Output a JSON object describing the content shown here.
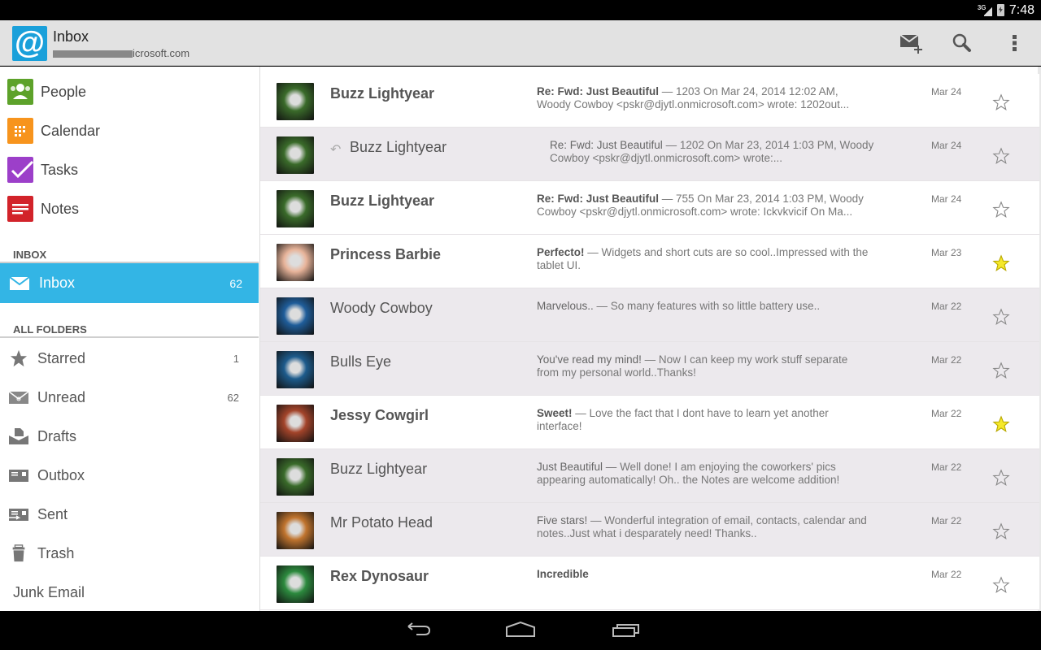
{
  "status_bar": {
    "network": "3G",
    "time": "7:48"
  },
  "action_bar": {
    "title": "Inbox",
    "account_visible_suffix": "icrosoft.com",
    "account_prefix_redacted": true,
    "actions": [
      {
        "name": "compose",
        "icon": "compose-mail-icon"
      },
      {
        "name": "search",
        "icon": "search-icon"
      },
      {
        "name": "overflow",
        "icon": "overflow-menu-icon"
      }
    ]
  },
  "sidebar": {
    "apps": [
      {
        "label": "People",
        "icon": "people-icon",
        "color": "#5da22a"
      },
      {
        "label": "Calendar",
        "icon": "calendar-icon",
        "color": "#f7941d"
      },
      {
        "label": "Tasks",
        "icon": "tasks-icon",
        "color": "#9c3fc9"
      },
      {
        "label": "Notes",
        "icon": "notes-icon",
        "color": "#d2232a"
      }
    ],
    "inbox_section": "INBOX",
    "selected": {
      "label": "Inbox",
      "count": "62",
      "icon": "mail-icon",
      "color": "#33b5e5"
    },
    "folders_section": "ALL FOLDERS",
    "folders": [
      {
        "label": "Starred",
        "count": "1",
        "icon": "star-icon"
      },
      {
        "label": "Unread",
        "count": "62",
        "icon": "unread-icon"
      },
      {
        "label": "Drafts",
        "count": "",
        "icon": "drafts-icon"
      },
      {
        "label": "Outbox",
        "count": "",
        "icon": "outbox-icon"
      },
      {
        "label": "Sent",
        "count": "",
        "icon": "sent-icon"
      },
      {
        "label": "Trash",
        "count": "",
        "icon": "trash-icon"
      },
      {
        "label": "Junk Email",
        "count": "",
        "icon": ""
      }
    ]
  },
  "messages": [
    {
      "sender": "Buzz Lightyear",
      "unread": true,
      "replied": false,
      "subject": "Re: Fwd: Just Beautiful",
      "preview": "1203 On Mar 24, 2014 12:02 AM, Woody Cowboy <pskr@djytl.onmicrosoft.com> wrote: 1202out...",
      "date": "Mar 24",
      "starred": false,
      "avatar_color": "#3a6b2a"
    },
    {
      "sender": "Buzz Lightyear",
      "unread": false,
      "replied": true,
      "subject": "Re: Fwd: Just Beautiful",
      "preview": "1202 On Mar 23, 2014 1:03 PM, Woody Cowboy <pskr@djytl.onmicrosoft.com> wrote:...",
      "date": "Mar 24",
      "starred": false,
      "avatar_color": "#3a6b2a"
    },
    {
      "sender": "Buzz Lightyear",
      "unread": true,
      "replied": false,
      "subject": "Re: Fwd: Just Beautiful",
      "preview": "755 On Mar 23, 2014 1:03 PM, Woody Cowboy <pskr@djytl.onmicrosoft.com> wrote: Ickvkvicif On Ma...",
      "date": "Mar 24",
      "starred": false,
      "avatar_color": "#3a6b2a"
    },
    {
      "sender": "Princess Barbie",
      "unread": true,
      "replied": false,
      "subject": "Perfecto!",
      "preview": "Widgets and short cuts are so cool..Impressed with the tablet UI.",
      "date": "Mar 23",
      "starred": true,
      "avatar_color": "#e8b49a"
    },
    {
      "sender": "Woody Cowboy",
      "unread": false,
      "replied": false,
      "subject": "Marvelous..",
      "preview": "So many features with so little battery use..",
      "date": "Mar 22",
      "starred": false,
      "avatar_color": "#1f5d9a"
    },
    {
      "sender": "Bulls Eye",
      "unread": false,
      "replied": false,
      "subject": "You've read my mind!",
      "preview": "Now I can keep my work stuff separate from my personal world..Thanks!",
      "date": "Mar 22",
      "starred": false,
      "avatar_color": "#1d5b8c"
    },
    {
      "sender": "Jessy Cowgirl",
      "unread": true,
      "replied": false,
      "subject": "Sweet!",
      "preview": "Love the fact that I dont have to learn yet another interface!",
      "date": "Mar 22",
      "starred": true,
      "avatar_color": "#a3442a"
    },
    {
      "sender": "Buzz Lightyear",
      "unread": false,
      "replied": false,
      "subject": "Just Beautiful",
      "preview": "Well done! I am enjoying the coworkers' pics appearing automatically! Oh.. the Notes are welcome addition!",
      "date": "Mar 22",
      "starred": false,
      "avatar_color": "#3a6b2a"
    },
    {
      "sender": "Mr Potato Head",
      "unread": false,
      "replied": false,
      "subject": "Five stars!",
      "preview": "Wonderful integration of email, contacts, calendar and notes..Just what i desparately need! Thanks..",
      "date": "Mar 22",
      "starred": false,
      "avatar_color": "#c0742e"
    },
    {
      "sender": "Rex Dynosaur",
      "unread": true,
      "replied": false,
      "subject": "Incredible",
      "preview": "",
      "date": "Mar 22",
      "starred": false,
      "avatar_color": "#2c8a3e"
    }
  ],
  "nav_bar": {
    "buttons": [
      "back",
      "home",
      "recents"
    ]
  },
  "colors": {
    "accent": "#33b5e5",
    "star_on": "#f5e82a",
    "read_row_bg": "#ece9ed"
  }
}
